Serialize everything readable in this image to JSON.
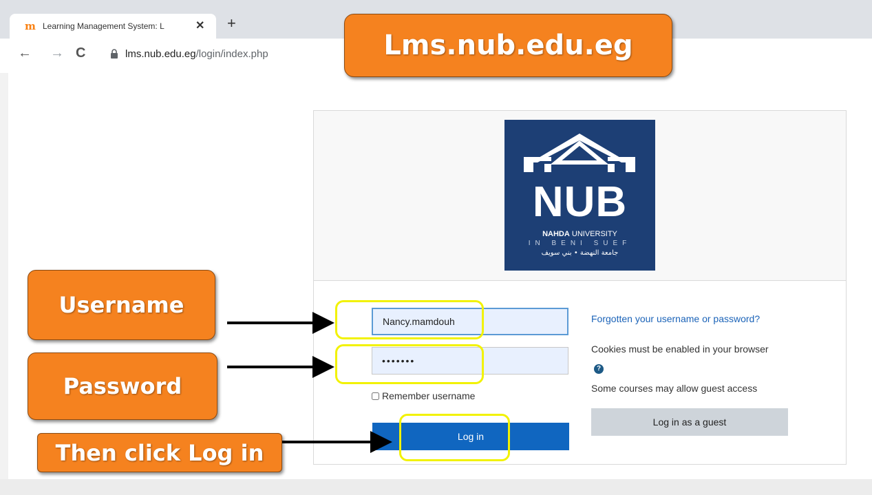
{
  "browser": {
    "tab_title": "Learning Management System: L",
    "tab_favicon": "m",
    "new_tab": "+",
    "tab_close": "✕",
    "back": "←",
    "forward": "→",
    "reload": "C",
    "url_host": "lms.nub.edu.eg",
    "url_path": "/login/index.php"
  },
  "logo": {
    "mark": "NUB",
    "name_bold": "NAHDA",
    "name_rest": " UNIVERSITY",
    "city": "IN BENI SUEF",
    "arabic": "جامعة النهضة • بني سويف"
  },
  "form": {
    "username_value": "Nancy.mamdouh",
    "password_value": "•••••••",
    "remember_label": "Remember username",
    "login_label": "Log in"
  },
  "side": {
    "forgot_link": "Forgotten your username or password?",
    "cookies_text": "Cookies must be enabled in your browser",
    "help_icon": "?",
    "guest_text": "Some courses may allow guest access",
    "guest_button": "Log in as a guest"
  },
  "annotations": {
    "url_callout": "Lms.nub.edu.eg",
    "username_callout": "Username",
    "password_callout": "Password",
    "login_callout": "Then click Log in"
  },
  "colors": {
    "callout_orange": "#f5821f",
    "highlight_yellow": "#f2f200",
    "login_blue": "#1066c0",
    "logo_navy": "#1d3f75"
  }
}
